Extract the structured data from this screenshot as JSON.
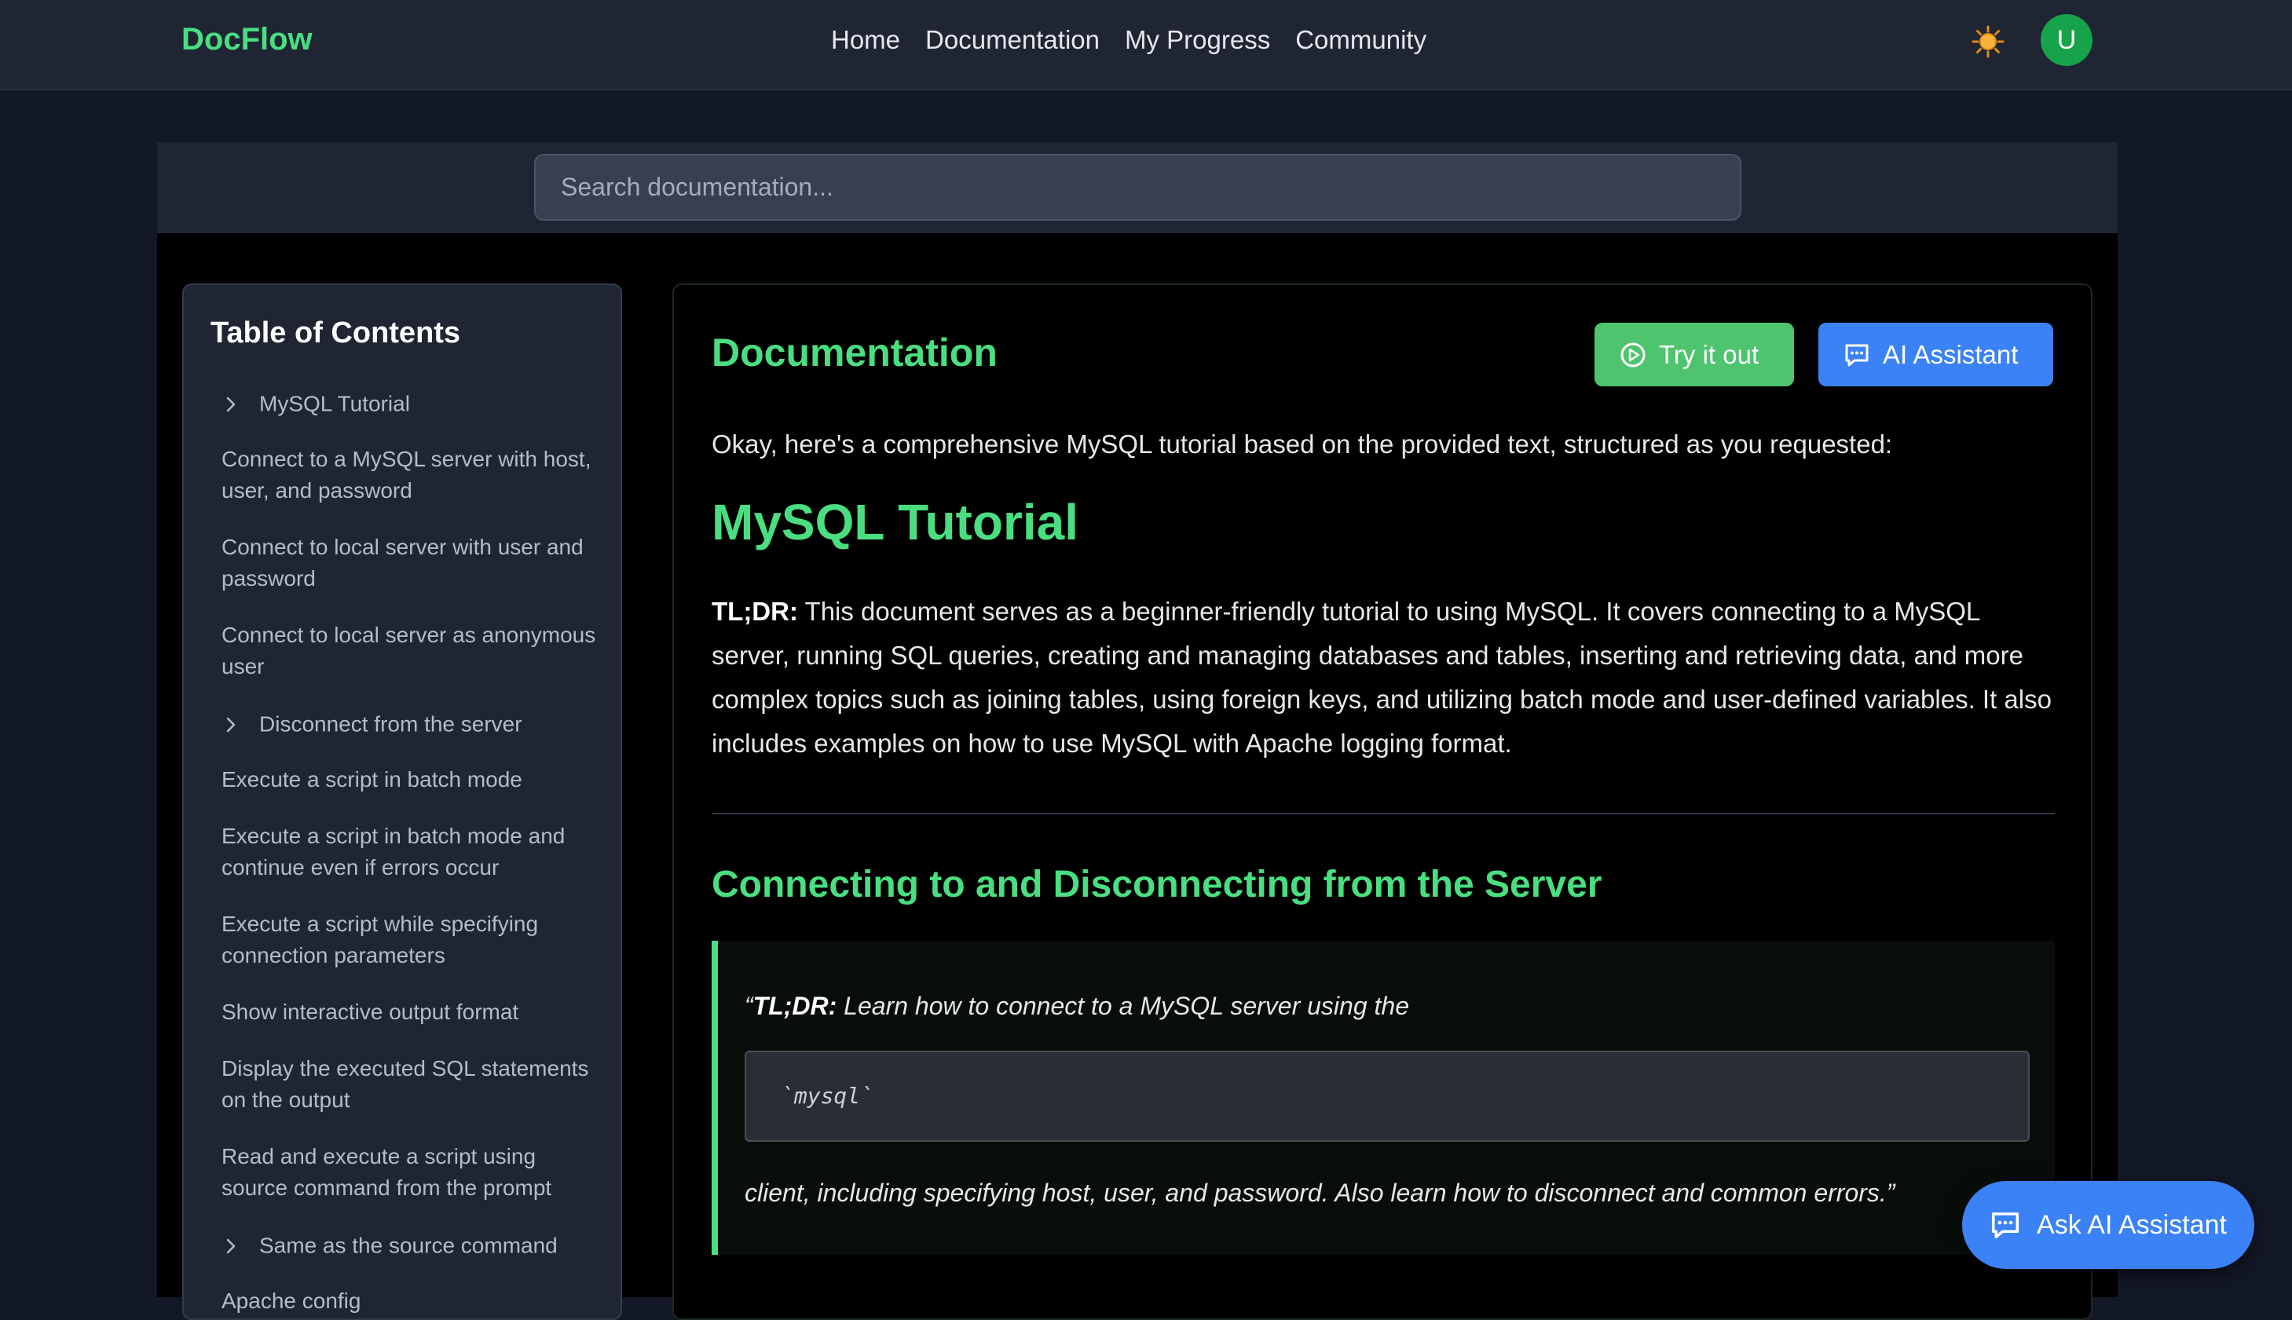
{
  "header": {
    "brand": "DocFlow",
    "nav": [
      "Home",
      "Documentation",
      "My Progress",
      "Community"
    ],
    "avatar_initial": "U",
    "theme_icon": "sun-icon"
  },
  "search": {
    "placeholder": "Search documentation..."
  },
  "toc": {
    "title": "Table of Contents",
    "items": [
      {
        "label": "MySQL Tutorial",
        "expandable": true
      },
      {
        "label": "Connect to a MySQL server with host, user, and password",
        "expandable": false
      },
      {
        "label": "Connect to local server with user and password",
        "expandable": false
      },
      {
        "label": "Connect to local server as anonymous user",
        "expandable": false
      },
      {
        "label": "Disconnect from the server",
        "expandable": true
      },
      {
        "label": "Execute a script in batch mode",
        "expandable": false
      },
      {
        "label": "Execute a script in batch mode and continue even if errors occur",
        "expandable": false
      },
      {
        "label": "Execute a script while specifying connection parameters",
        "expandable": false
      },
      {
        "label": "Show interactive output format",
        "expandable": false
      },
      {
        "label": "Display the executed SQL statements on the output",
        "expandable": false
      },
      {
        "label": "Read and execute a script using source command from the prompt",
        "expandable": false
      },
      {
        "label": "Same as the source command",
        "expandable": true
      },
      {
        "label": "Apache config",
        "expandable": false
      }
    ]
  },
  "doc": {
    "heading": "Documentation",
    "try_label": "Try it out",
    "ai_label": "AI Assistant",
    "intro": "Okay, here's a comprehensive MySQL tutorial based on the provided text, structured as you requested:",
    "h1": "MySQL Tutorial",
    "tldr_label": "TL;DR:",
    "tldr_text": " This document serves as a beginner-friendly tutorial to using MySQL. It covers connecting to a MySQL server, running SQL queries, creating and managing databases and tables, inserting and retrieving data, and more complex topics such as joining tables, using foreign keys, and utilizing batch mode and user-defined variables. It also includes examples on how to use MySQL with Apache logging format.",
    "h2": "Connecting to and Disconnecting from the Server",
    "quote_open": "“",
    "quote_label": "TL;DR:",
    "quote_line1": " Learn how to connect to a MySQL server using the",
    "code": "`mysql`",
    "quote_line2": "client, including specifying host, user, and password. Also learn how to disconnect and common errors.”"
  },
  "fab": {
    "label": "Ask AI Assistant"
  },
  "colors": {
    "accent_green": "#4ade80",
    "button_green": "#4ec46f",
    "accent_blue": "#3b82f6"
  }
}
